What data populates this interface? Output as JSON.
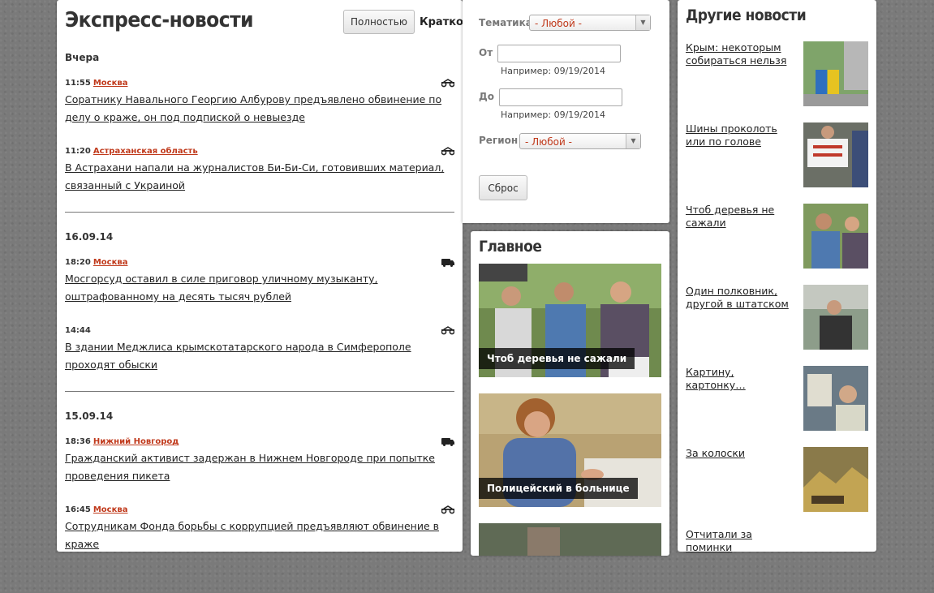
{
  "express": {
    "title": "Экспресс-новости",
    "view_full": "Полностью",
    "view_short": "Кратко",
    "days": [
      {
        "label": "Вчера",
        "items": [
          {
            "time": "11:55",
            "region": "Москва",
            "headline": "Соратнику Навального Георгию Албурову предъявлено обвинение по делу о краже, он под подпиской о невыезде",
            "icon": "handcuffs-icon"
          },
          {
            "time": "11:20",
            "region": "Астраханская область",
            "headline": "В Астрахани напали на журналистов Би-Би-Си, готовивших материал, связанный с Украиной",
            "icon": "handcuffs-icon"
          }
        ]
      },
      {
        "label": "16.09.14",
        "items": [
          {
            "time": "18:20",
            "region": "Москва",
            "headline": "Мосгорсуд оставил в силе приговор уличному музыканту, оштрафованному на десять тысяч рублей",
            "icon": "police-van-icon"
          },
          {
            "time": "14:44",
            "region": "",
            "headline": "В здании Меджлиса крымскотатарского народа в Симферополе проходят обыски",
            "icon": "handcuffs-icon"
          }
        ]
      },
      {
        "label": "15.09.14",
        "items": [
          {
            "time": "18:36",
            "region": "Нижний Новгород",
            "headline": "Гражданский активист задержан в Нижнем Новгороде при попытке проведения пикета",
            "icon": "police-van-icon"
          },
          {
            "time": "16:45",
            "region": "Москва",
            "headline": "Сотрудникам Фонда борьбы с коррупцией предъявляют обвинение в краже",
            "icon": "handcuffs-icon"
          }
        ]
      }
    ]
  },
  "filters": {
    "topic_label": "Тематика",
    "topic_value": "- Любой -",
    "from_label": "От",
    "from_value": "",
    "from_hint": "Например: 09/19/2014",
    "to_label": "До",
    "to_value": "",
    "to_hint": "Например: 09/19/2014",
    "region_label": "Регион",
    "region_value": "- Любой -",
    "reset_label": "Сброс"
  },
  "main_news": {
    "title": "Главное",
    "cards": [
      {
        "caption": "Чтоб деревья не сажали"
      },
      {
        "caption": "Полицейский в больнице"
      }
    ]
  },
  "other_news": {
    "title": "Другие новости",
    "items": [
      {
        "label": "Крым: некоторым собираться нельзя"
      },
      {
        "label": "Шины проколоть или по голове"
      },
      {
        "label": "Чтоб деревья не сажали"
      },
      {
        "label": "Один полковник, другой в штатском"
      },
      {
        "label": "Картину, картонку…"
      },
      {
        "label": "За колоски"
      },
      {
        "label": "Отчитали за поминки"
      }
    ]
  }
}
